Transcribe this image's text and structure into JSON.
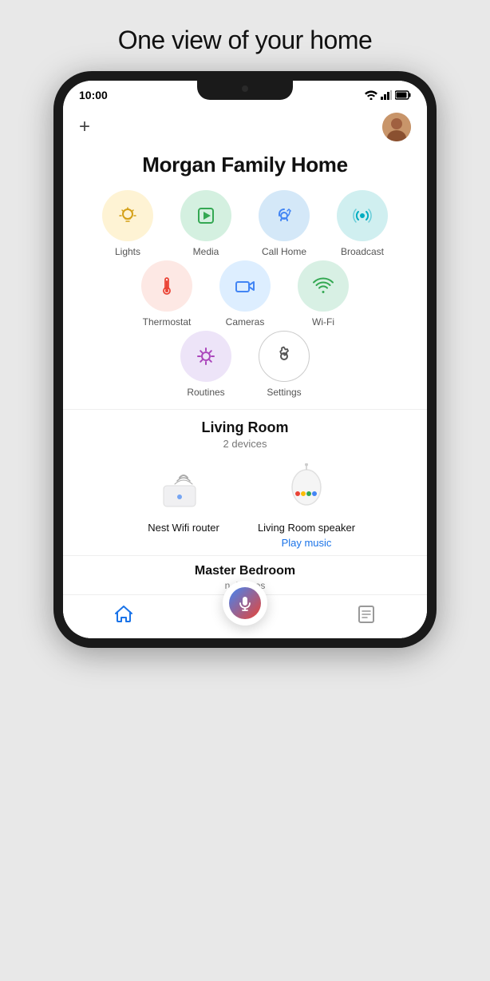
{
  "page": {
    "title": "One view of your home"
  },
  "status_bar": {
    "time": "10:00"
  },
  "header": {
    "plus_label": "+",
    "home_title": "Morgan Family Home"
  },
  "quick_actions": {
    "row1": [
      {
        "id": "lights",
        "label": "Lights",
        "circle_class": "circle-yellow",
        "icon_type": "bulb",
        "color": "#d4a017"
      },
      {
        "id": "media",
        "label": "Media",
        "circle_class": "circle-green",
        "icon_type": "play",
        "color": "#34a853"
      },
      {
        "id": "call-home",
        "label": "Call Home",
        "circle_class": "circle-blue",
        "icon_type": "call",
        "color": "#4285f4"
      },
      {
        "id": "broadcast",
        "label": "Broadcast",
        "circle_class": "circle-teal",
        "icon_type": "broadcast",
        "color": "#00acc1"
      }
    ],
    "row2": [
      {
        "id": "thermostat",
        "label": "Thermostat",
        "circle_class": "circle-red",
        "icon_type": "thermostat",
        "color": "#ea4335"
      },
      {
        "id": "cameras",
        "label": "Cameras",
        "circle_class": "circle-blue2",
        "icon_type": "camera",
        "color": "#4285f4"
      },
      {
        "id": "wifi",
        "label": "Wi-Fi",
        "circle_class": "circle-green2",
        "icon_type": "wifi",
        "color": "#34a853"
      }
    ],
    "row3": [
      {
        "id": "routines",
        "label": "Routines",
        "circle_class": "circle-purple",
        "icon_type": "sun",
        "color": "#ab47bc"
      },
      {
        "id": "settings",
        "label": "Settings",
        "circle_class": "circle-white",
        "icon_type": "gear",
        "color": "#555"
      }
    ]
  },
  "living_room": {
    "title": "Living Room",
    "subtitle": "2 devices",
    "devices": [
      {
        "id": "nest-wifi",
        "label": "Nest Wifi router",
        "action": null
      },
      {
        "id": "lr-speaker",
        "label": "Living Room speaker",
        "action": "Play music"
      }
    ]
  },
  "master_bedroom": {
    "title": "Master Bedroom",
    "subtitle": "n devices"
  },
  "bottom_nav": {
    "home_label": "home",
    "mic_label": "mic",
    "notes_label": "notes"
  }
}
